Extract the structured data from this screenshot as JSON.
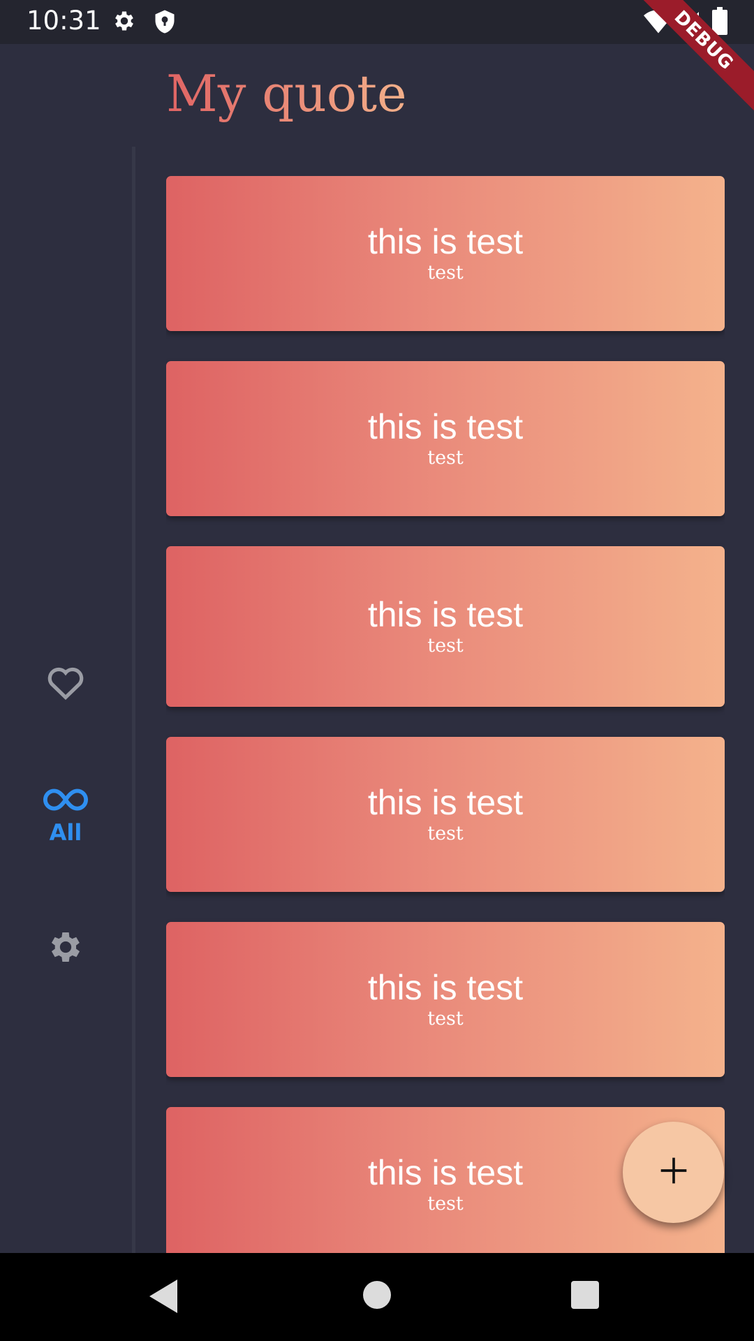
{
  "status_bar": {
    "time": "10:31",
    "icons": [
      "settings-gear-icon",
      "shield-icon",
      "wifi-icon",
      "cellular-signal-icon",
      "battery-icon"
    ]
  },
  "debug_banner": "DEBUG",
  "header": {
    "title": "My quote"
  },
  "nav_rail": {
    "items": [
      {
        "icon": "heart-outline-icon",
        "label": "",
        "selected": false
      },
      {
        "icon": "infinity-icon",
        "label": "All",
        "selected": true
      },
      {
        "icon": "settings-gear-icon",
        "label": "",
        "selected": false
      }
    ]
  },
  "quotes": [
    {
      "text": "this is test",
      "author": "test"
    },
    {
      "text": "this is test",
      "author": "test"
    },
    {
      "text": "this is test",
      "author": "test"
    },
    {
      "text": "this is test",
      "author": "test"
    },
    {
      "text": "this is test",
      "author": "test"
    },
    {
      "text": "this is test",
      "author": "test"
    }
  ],
  "fab": {
    "icon": "plus-icon"
  },
  "system_nav": {
    "buttons": [
      "back-icon",
      "home-icon",
      "recents-icon"
    ]
  },
  "colors": {
    "background": "#2d2e3f",
    "status_bar": "#24252f",
    "card_gradient_start": "#de6363",
    "card_gradient_end": "#f4b28c",
    "accent_selected": "#2f8ff0",
    "icon_unselected": "#9a9ca4",
    "fab": "#f6c7a4"
  }
}
